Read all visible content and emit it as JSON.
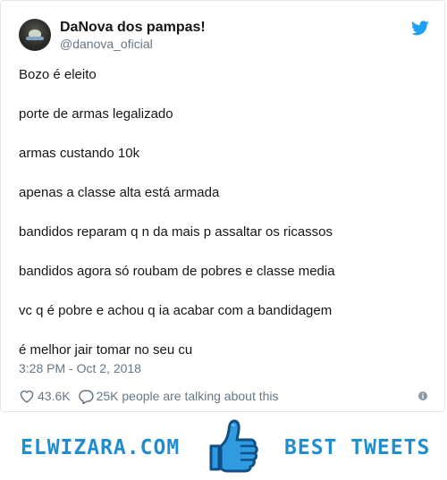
{
  "tweet": {
    "display_name": "DaNova dos pampas!",
    "handle": "@danova_oficial",
    "lines": [
      "Bozo é eleito",
      "porte de armas legalizado",
      "armas custando 10k",
      "apenas a classe alta está armada",
      "bandidos reparam q n da mais p assaltar os ricassos",
      "bandidos agora só roubam de pobres e classe media",
      "vc q é pobre e achou q ia acabar com a bandidagem",
      "é melhor jair tomar no seu cu"
    ],
    "timestamp": "3:28 PM - Oct 2, 2018",
    "likes": "43.6K",
    "conversation": "25K people are talking about this"
  },
  "banner": {
    "left_text": "ELWIZARA.COM",
    "right_text": "BEST TWEETS"
  },
  "icons": {
    "avatar": "avatar",
    "brand": "twitter-bird-icon",
    "like": "heart-icon",
    "reply": "speech-bubble-icon",
    "info": "info-icon",
    "banner": "thumbs-up-icon"
  },
  "colors": {
    "text": "#14171a",
    "muted": "#657786",
    "twitter_blue": "#1da1f2",
    "banner_blue": "#1e8ed0",
    "border": "#e1e8ed"
  }
}
